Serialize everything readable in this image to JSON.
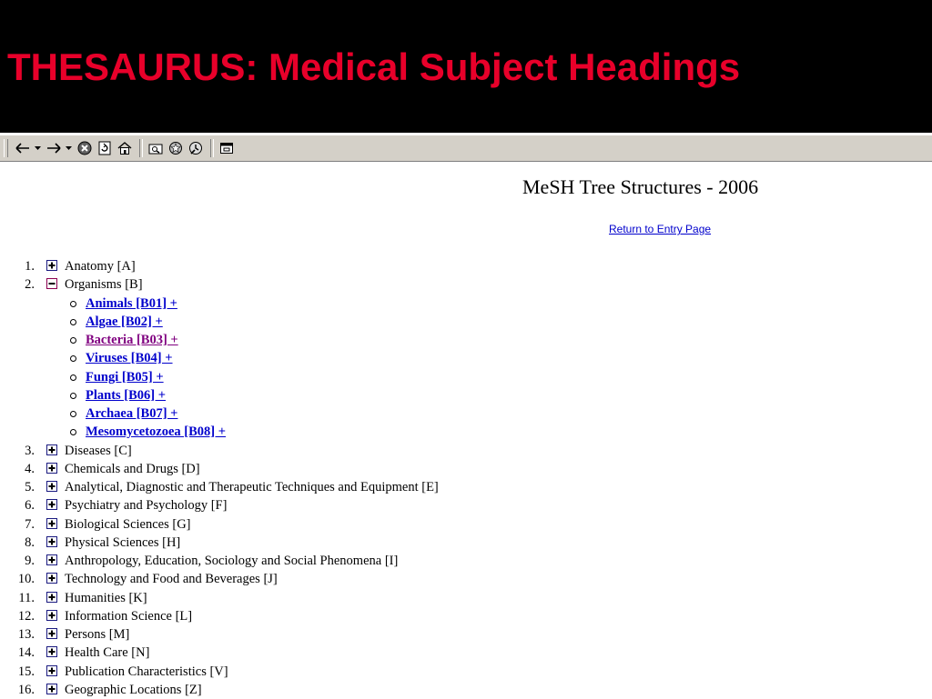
{
  "slide": {
    "title": "THESAURUS: Medical Subject Headings"
  },
  "colors": {
    "title_red": "#e8002a",
    "link_blue": "#0000cc",
    "link_visited": "#800080"
  },
  "toolbar": {
    "buttons": [
      "back-arrow-icon",
      "forward-arrow-icon",
      "stop-icon",
      "refresh-icon",
      "home-icon",
      "search-icon",
      "favorites-icon",
      "history-icon",
      "fullscreen-icon"
    ]
  },
  "page": {
    "heading": "MeSH Tree Structures - 2006",
    "return_link": "Return to Entry Page"
  },
  "tree": {
    "categories": [
      {
        "num": "1.",
        "label": "Anatomy [A]"
      },
      {
        "num": "2.",
        "label": "Organisms [B]",
        "expanded": true
      },
      {
        "num": "3.",
        "label": "Diseases [C]"
      },
      {
        "num": "4.",
        "label": "Chemicals and Drugs [D]"
      },
      {
        "num": "5.",
        "label": "Analytical, Diagnostic and Therapeutic Techniques and Equipment [E]"
      },
      {
        "num": "6.",
        "label": "Psychiatry and Psychology [F]"
      },
      {
        "num": "7.",
        "label": "Biological Sciences [G]"
      },
      {
        "num": "8.",
        "label": "Physical Sciences [H]"
      },
      {
        "num": "9.",
        "label": "Anthropology, Education, Sociology and Social Phenomena [I]"
      },
      {
        "num": "10.",
        "label": "Technology and Food and Beverages [J]"
      },
      {
        "num": "11.",
        "label": "Humanities [K]"
      },
      {
        "num": "12.",
        "label": "Information Science [L]"
      },
      {
        "num": "13.",
        "label": "Persons [M]"
      },
      {
        "num": "14.",
        "label": "Health Care [N]"
      },
      {
        "num": "15.",
        "label": "Publication Characteristics [V]"
      },
      {
        "num": "16.",
        "label": "Geographic Locations [Z]"
      }
    ],
    "organisms_children": [
      {
        "label": "Animals [B01]  +"
      },
      {
        "label": "Algae [B02]  +"
      },
      {
        "label": "Bacteria [B03]  +",
        "visited": true
      },
      {
        "label": "Viruses [B04]  +"
      },
      {
        "label": "Fungi [B05]  +"
      },
      {
        "label": "Plants [B06]  +"
      },
      {
        "label": "Archaea [B07]  +"
      },
      {
        "label": "Mesomycetozoea [B08]  +"
      }
    ]
  }
}
